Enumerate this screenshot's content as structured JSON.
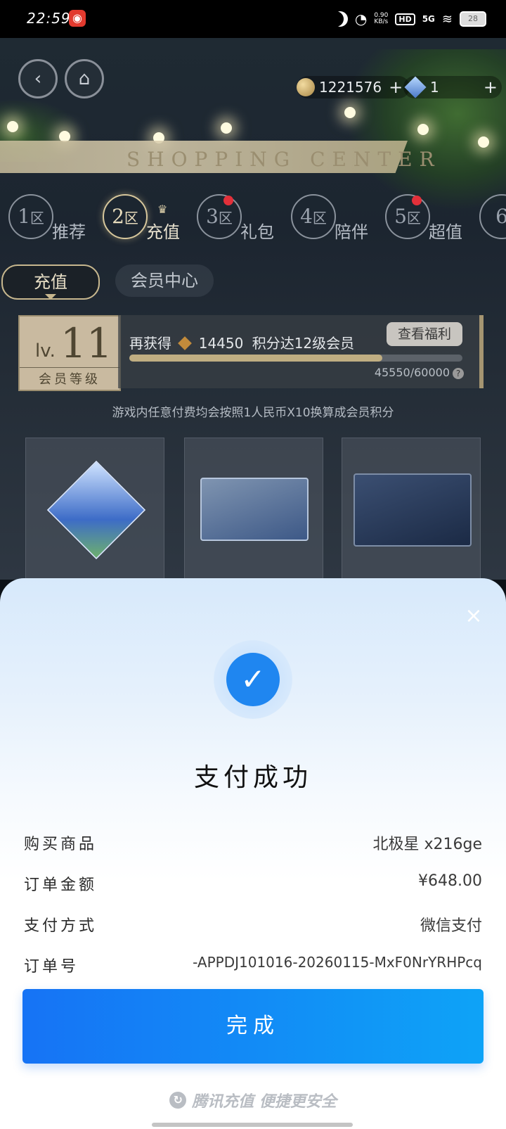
{
  "status_bar": {
    "time": "22:59",
    "app_icon": "netease-cloud-music-icon",
    "net_speed_value": "0.90",
    "net_speed_unit": "KB/s",
    "hd": "HD",
    "network": "5G",
    "battery": "28"
  },
  "game": {
    "coins": "1221576",
    "gems": "1",
    "banner": "SHOPPING CENTER",
    "zones": [
      {
        "number": "1",
        "suffix": "区",
        "label": "推荐"
      },
      {
        "number": "2",
        "suffix": "区",
        "label": "充值"
      },
      {
        "number": "3",
        "suffix": "区",
        "label": "礼包"
      },
      {
        "number": "4",
        "suffix": "区",
        "label": "陪伴"
      },
      {
        "number": "5",
        "suffix": "区",
        "label": "超值"
      },
      {
        "number": "6",
        "suffix": "",
        "label": ""
      }
    ],
    "subtabs": {
      "active": "充值",
      "other": "会员中心"
    },
    "vip": {
      "lv_prefix": "lv.",
      "level": "11",
      "caption": "会员等级",
      "text_before": "再获得",
      "points_needed": "14450",
      "text_after": "积分达12级会员",
      "benefits_button": "查看福利",
      "progress_count": "45550/60000",
      "progress_fraction": 0.759
    },
    "info_line": "游戏内任意付费均会按照1人民币X10换算成会员积分"
  },
  "payment": {
    "close": "×",
    "title": "支付成功",
    "rows": [
      {
        "label": "购买商品",
        "value": "北极星 x216ge"
      },
      {
        "label": "订单金额",
        "value": "¥648.00"
      },
      {
        "label": "支付方式",
        "value": "微信支付"
      },
      {
        "label": "订单号",
        "value": "-APPDJ101016-20260115-MxF0NrYRHPcq"
      }
    ],
    "done_button": "完成",
    "footer": "腾讯充值 便捷更安全"
  },
  "colors": {
    "primary_blue": "#1f86f0",
    "button_gradient_start": "#1673f5",
    "button_gradient_end": "#0ea3f7",
    "gold": "#c7b78e"
  }
}
